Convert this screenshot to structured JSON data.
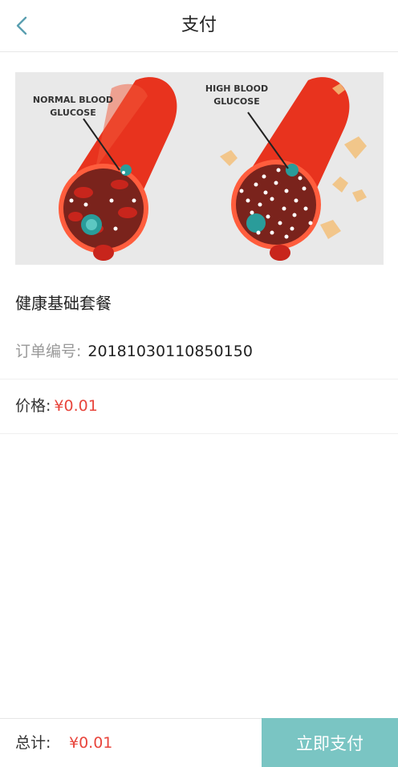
{
  "nav": {
    "back_icon": "chevron-left-icon",
    "title": "支付"
  },
  "banner": {
    "left_label_line1": "NORMAL BLOOD",
    "left_label_line2": "GLUCOSE",
    "right_label_line1": "HIGH BLOOD",
    "right_label_line2": "GLUCOSE"
  },
  "product": {
    "name": "健康基础套餐",
    "order_label": "订单编号:",
    "order_number": "20181030110850150",
    "price_label": "价格:",
    "price": "¥0.01"
  },
  "footer": {
    "total_label": "总计:",
    "total_value": "¥0.01",
    "pay_button": "立即支付"
  },
  "colors": {
    "accent": "#7ac5c3",
    "price": "#e8453c"
  }
}
